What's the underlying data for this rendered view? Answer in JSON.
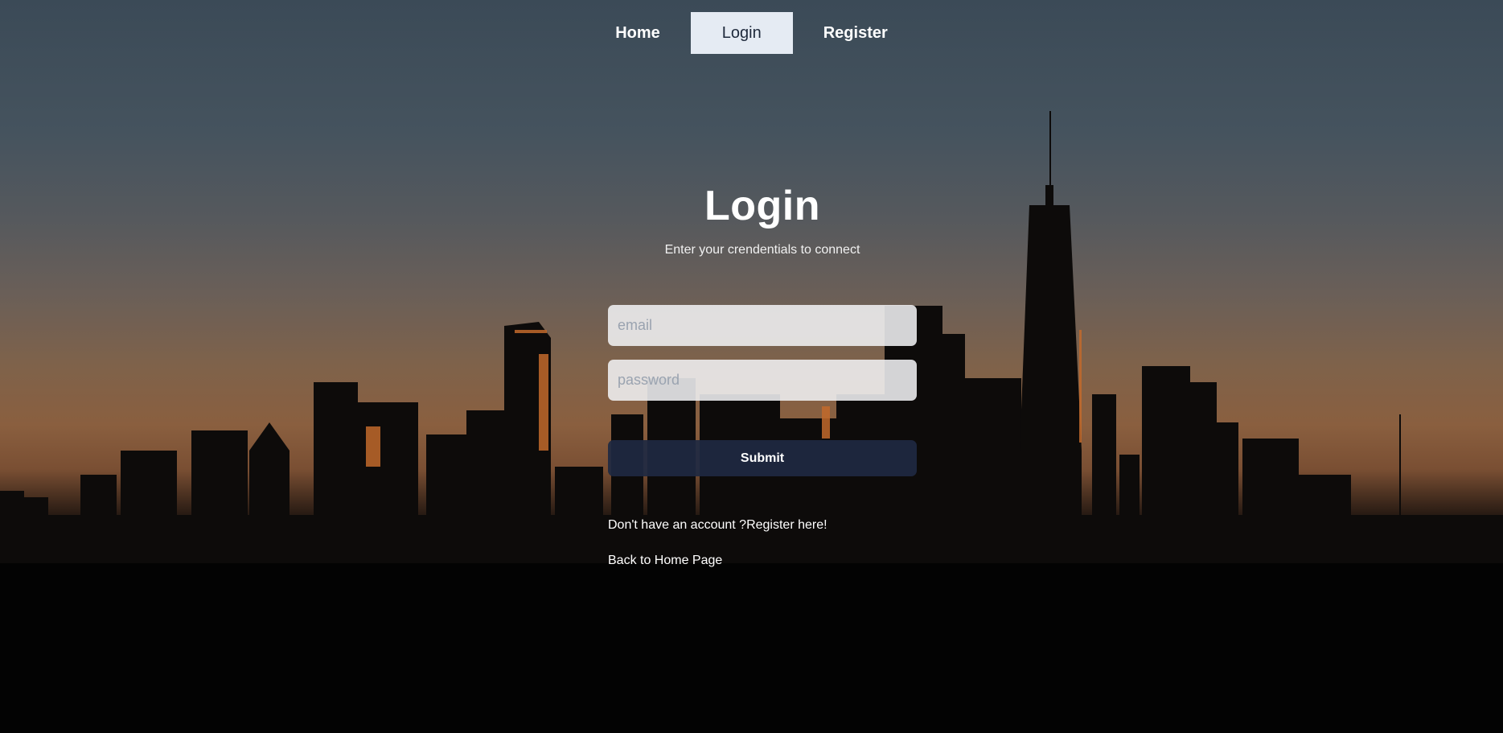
{
  "nav": {
    "items": [
      {
        "label": "Home",
        "active": false
      },
      {
        "label": "Login",
        "active": true
      },
      {
        "label": "Register",
        "active": false
      }
    ]
  },
  "login": {
    "title": "Login",
    "subtitle": "Enter your crendentials to connect",
    "email_placeholder": "email",
    "password_placeholder": "password",
    "submit_label": "Submit",
    "no_account_text": "Don't have an account ?",
    "register_link": "Register here!",
    "back_link": "Back to Home Page"
  },
  "background": {
    "icon": "city-skyline-dusk"
  }
}
